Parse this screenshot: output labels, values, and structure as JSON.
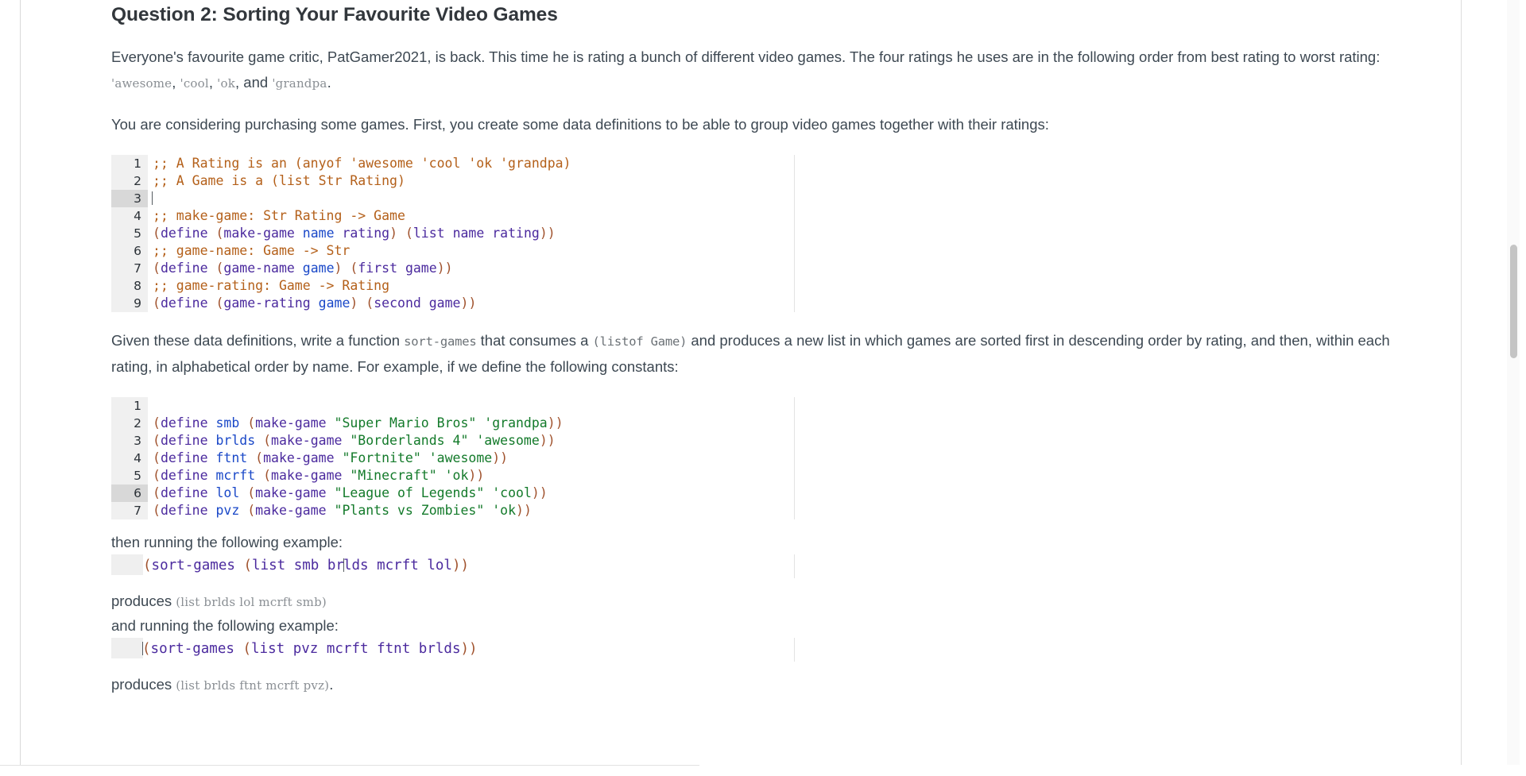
{
  "page": {
    "title": "Question 2: Sorting Your Favourite Video Games"
  },
  "intro": {
    "part1": "Everyone's favourite game critic, PatGamer2021, is back. This time he is rating a bunch of different video games. The four ratings he uses are in the following order from best rating to worst rating: ",
    "rating1": "'awesome",
    "sep1": ", ",
    "rating2": "'cool",
    "sep2": ", ",
    "rating3": "'ok",
    "sep3": ", and ",
    "rating4": "'grandpa",
    "end": "."
  },
  "paragraph2": "You are considering purchasing some games. First, you create some data definitions to be able to group video games together with their ratings:",
  "code_block_1": {
    "lines": [
      {
        "n": "1",
        "active": false,
        "text": ";; A Rating is an (anyof 'awesome 'cool 'ok 'grandpa)"
      },
      {
        "n": "2",
        "active": false,
        "text": ";; A Game is a (list Str Rating)"
      },
      {
        "n": "3",
        "active": true,
        "text": ""
      },
      {
        "n": "4",
        "active": false,
        "text": ";; make-game: Str Rating -> Game"
      },
      {
        "n": "5",
        "active": false,
        "text": "(define (make-game name rating) (list name rating))"
      },
      {
        "n": "6",
        "active": false,
        "text": ";; game-name: Game -> Str"
      },
      {
        "n": "7",
        "active": false,
        "text": "(define (game-name game) (first game))"
      },
      {
        "n": "8",
        "active": false,
        "text": ";; game-rating: Game -> Rating"
      },
      {
        "n": "9",
        "active": false,
        "text": "(define (game-rating game) (second game))"
      }
    ]
  },
  "paragraph3": {
    "a": "Given these data definitions, write a function ",
    "fn": "sort-games",
    "b": " that consumes a ",
    "type": "(listof Game)",
    "c": " and produces a new list in which games are sorted first in descending order by rating, and then, within each rating, in alphabetical order by name. For example, if we define the following constants:"
  },
  "code_block_2": {
    "lines": [
      {
        "n": "1",
        "active": false,
        "text": ""
      },
      {
        "n": "2",
        "active": false,
        "text": "(define smb (make-game \"Super Mario Bros\" 'grandpa))"
      },
      {
        "n": "3",
        "active": false,
        "text": "(define brlds (make-game \"Borderlands 4\" 'awesome))"
      },
      {
        "n": "4",
        "active": false,
        "text": "(define ftnt (make-game \"Fortnite\" 'awesome))"
      },
      {
        "n": "5",
        "active": false,
        "text": "(define mcrft (make-game \"Minecraft\" 'ok))"
      },
      {
        "n": "6",
        "active": true,
        "text": "(define lol (make-game \"League of Legends\" 'cool))"
      },
      {
        "n": "7",
        "active": false,
        "text": "(define pvz (make-game \"Plants vs Zombies\" 'ok))"
      }
    ]
  },
  "example1": {
    "label": "then running the following example:",
    "code_before": "(sort-games (list smb br",
    "code_after": "lds mcrft lol))",
    "produces_label": "produces ",
    "produces_value": "(list brlds lol mcrft smb)"
  },
  "example2": {
    "label": "and running the following example:",
    "code": "(sort-games (list pvz mcrft ftnt brlds))",
    "produces_label": "produces ",
    "produces_value": "(list brlds ftnt mcrft pvz)",
    "period": "."
  },
  "colors": {
    "comment": "#b4601a",
    "paren": "#a0522d",
    "keyword": "#4b2a9e",
    "variable": "#1a48c8",
    "string": "#137a2a",
    "gutter_bg": "#f0f0f0",
    "active_line_bg": "#d8d8d8",
    "body_text": "#3d4852",
    "scrollbar_thumb": "#c4c4c4"
  }
}
